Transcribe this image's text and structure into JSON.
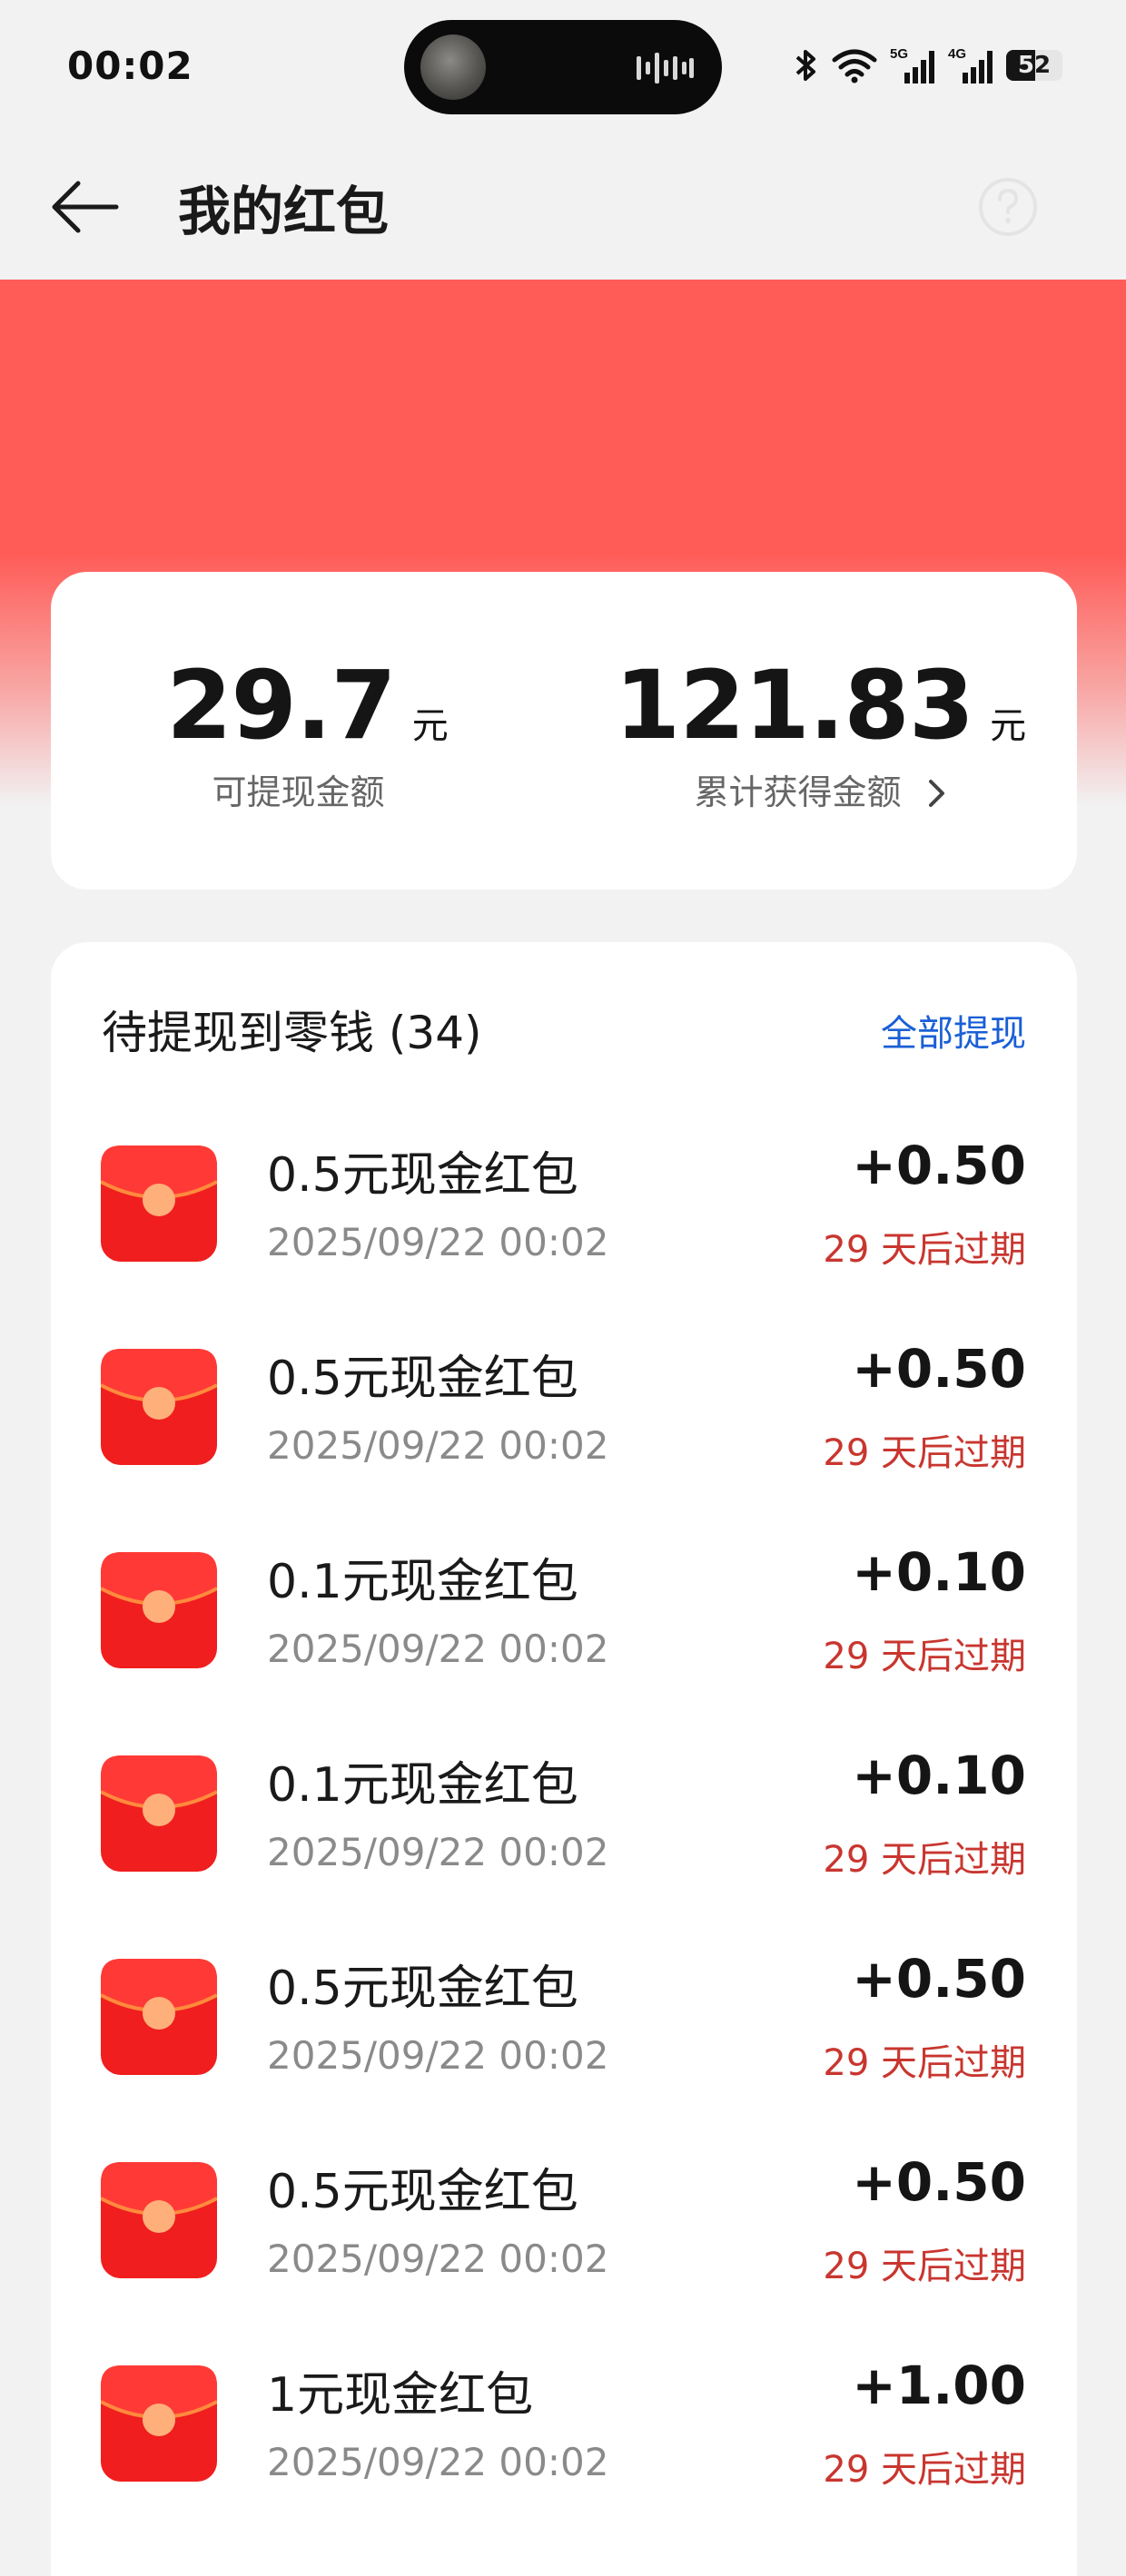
{
  "status_bar": {
    "time": "00:02",
    "network_5g": "5G",
    "network_4g": "4G",
    "battery": "52"
  },
  "header": {
    "title": "我的红包"
  },
  "summary": {
    "withdrawable": {
      "amount": "29.7",
      "unit": "元",
      "label": "可提现金额"
    },
    "total": {
      "amount": "121.83",
      "unit": "元",
      "label": "累计获得金额"
    }
  },
  "list": {
    "title": "待提现到零钱 (34)",
    "withdraw_all": "全部提现",
    "items": [
      {
        "name": "0.5元现金红包",
        "date": "2025/09/22 00:02",
        "amount": "+0.50",
        "expire": "29 天后过期"
      },
      {
        "name": "0.5元现金红包",
        "date": "2025/09/22 00:02",
        "amount": "+0.50",
        "expire": "29 天后过期"
      },
      {
        "name": "0.1元现金红包",
        "date": "2025/09/22 00:02",
        "amount": "+0.10",
        "expire": "29 天后过期"
      },
      {
        "name": "0.1元现金红包",
        "date": "2025/09/22 00:02",
        "amount": "+0.10",
        "expire": "29 天后过期"
      },
      {
        "name": "0.5元现金红包",
        "date": "2025/09/22 00:02",
        "amount": "+0.50",
        "expire": "29 天后过期"
      },
      {
        "name": "0.5元现金红包",
        "date": "2025/09/22 00:02",
        "amount": "+0.50",
        "expire": "29 天后过期"
      },
      {
        "name": "1元现金红包",
        "date": "2025/09/22 00:02",
        "amount": "+1.00",
        "expire": "29 天后过期"
      }
    ]
  },
  "colors": {
    "banner": "#ff5b57",
    "link": "#1a5fd6",
    "expire": "#c8362f",
    "envelope": "#f01e1e"
  },
  "icons": {
    "back": "arrow-left-icon",
    "help": "question-circle-icon",
    "chevron": "chevron-right-icon",
    "envelope": "red-envelope-icon"
  }
}
